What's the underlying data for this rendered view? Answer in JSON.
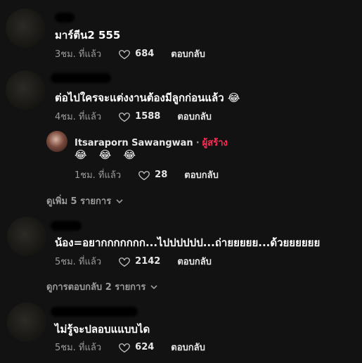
{
  "comments": [
    {
      "text": "มาร์ตีน2 555",
      "time": "3ชม. ที่แล้ว",
      "likes": "684",
      "reply_label": "ตอบกลับ"
    },
    {
      "text": "ต่อไปใครจะแต่งงานต้องมีลูกก่อนแล้ว 😂",
      "time": "4ชม. ที่แล้ว",
      "likes": "1588",
      "reply_label": "ตอบกลับ",
      "replies": [
        {
          "author": "Itsaraporn Sawangwan",
          "separator": "·",
          "badge": "ผู้สร้าง",
          "text": "😂 😂 😂",
          "time": "1ชม. ที่แล้ว",
          "likes": "28",
          "reply_label": "ตอบกลับ"
        }
      ],
      "more_label": "ดูเพิ่ม 5 รายการ"
    },
    {
      "text": "น้อง=อยากกกกกกก...ไปปปปปป...ถ่ายยยยย...ด้วยยยยยย",
      "time": "5ชม. ที่แล้ว",
      "likes": "2142",
      "reply_label": "ตอบกลับ",
      "more_label": "ดูการตอบกลับ 2 รายการ"
    },
    {
      "text": "ไม่รู้จะปลอบแแบบได",
      "time": "5ชม. ที่แล้ว",
      "likes": "624",
      "reply_label": "ตอบกลับ"
    }
  ],
  "colors": {
    "background": "#121212",
    "creator_badge": "#fe2c55",
    "secondary_text": "#9b9b9b"
  },
  "icons": {
    "like": "heart-outline-icon",
    "expand": "chevron-down-icon"
  }
}
